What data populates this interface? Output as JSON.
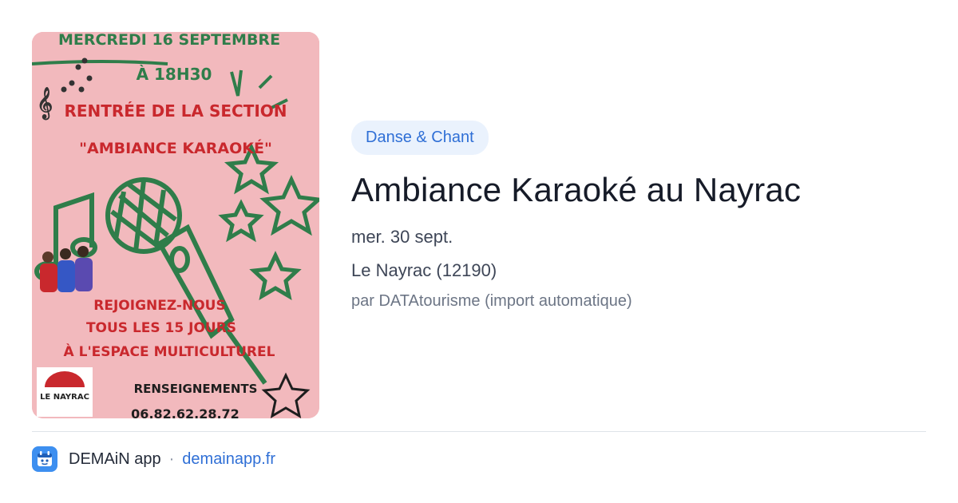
{
  "poster": {
    "line1": "MERCREDI 16 SEPTEMBRE",
    "line2": "À 18H30",
    "line3": "RENTRÉE DE LA SECTION",
    "line4": "\"AMBIANCE KARAOKÉ\"",
    "line5": "REJOIGNEZ-NOUS",
    "line6": "TOUS LES 15 JOURS",
    "line7": "À L'ESPACE MULTICULTUREL",
    "info_label": "RENSEIGNEMENTS",
    "phone": "06.82.62.28.72",
    "logo_text": "LE NAYRAC"
  },
  "event": {
    "category": "Danse & Chant",
    "title": "Ambiance Karaoké au Nayrac",
    "date": "mer. 30 sept.",
    "location": "Le Nayrac (12190)",
    "source": "par DATAtourisme (import automatique)"
  },
  "footer": {
    "app_name": "DEMAiN app",
    "separator": "·",
    "url": "demainapp.fr"
  },
  "colors": {
    "poster_bg": "#f2b9bd",
    "poster_green": "#2f7d4a",
    "poster_red": "#c9282d",
    "tag_bg": "#eaf2fd",
    "accent": "#2f6fd6"
  }
}
